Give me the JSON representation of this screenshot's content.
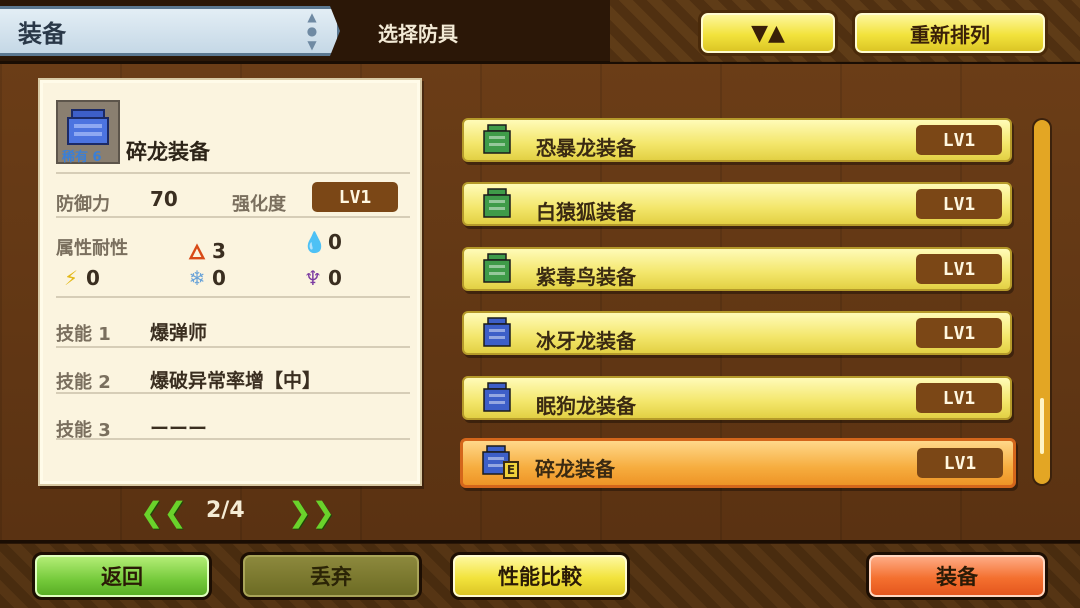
{
  "header": {
    "title": "装备",
    "subtitle": "选择防具",
    "sort_label": "▼▲",
    "reorder_label": "重新排列"
  },
  "detail": {
    "rarity": "稀有 6",
    "name": "碎龙装备",
    "defense_label": "防御力",
    "defense_value": "70",
    "upgrade_label": "强化度",
    "upgrade_value": "LV1",
    "resist_label": "属性耐性",
    "resist": {
      "fire": "3",
      "water": "0",
      "thunder": "0",
      "ice": "0",
      "dragon": "0"
    },
    "skills": [
      {
        "label": "技能 1",
        "value": "爆弹师"
      },
      {
        "label": "技能 2",
        "value": "爆破异常率增【中】"
      },
      {
        "label": "技能 3",
        "value": "ーーー"
      }
    ],
    "page": "2/4"
  },
  "armor_list": [
    {
      "name": "恐暴龙装备",
      "level": "LV1",
      "icon": "green-armor-icon",
      "selected": false
    },
    {
      "name": "白猿狐装备",
      "level": "LV1",
      "icon": "green-armor-icon",
      "selected": false
    },
    {
      "name": "紫毒鸟装备",
      "level": "LV1",
      "icon": "green-armor-icon",
      "selected": false
    },
    {
      "name": "冰牙龙装备",
      "level": "LV1",
      "icon": "blue-armor-icon",
      "selected": false
    },
    {
      "name": "眠狗龙装备",
      "level": "LV1",
      "icon": "blue-armor-icon",
      "selected": false
    },
    {
      "name": "碎龙装备",
      "level": "LV1",
      "icon": "blue-armor-icon",
      "selected": true,
      "equipped_mark": "E"
    }
  ],
  "footer": {
    "back": "返回",
    "discard": "丢弃",
    "compare": "性能比較",
    "equip": "装备"
  },
  "colors": {
    "green_armor": "#3f9b49",
    "blue_armor": "#3d5fc8",
    "selected_row": "#f6ad3f",
    "row": "#f3e66a"
  }
}
